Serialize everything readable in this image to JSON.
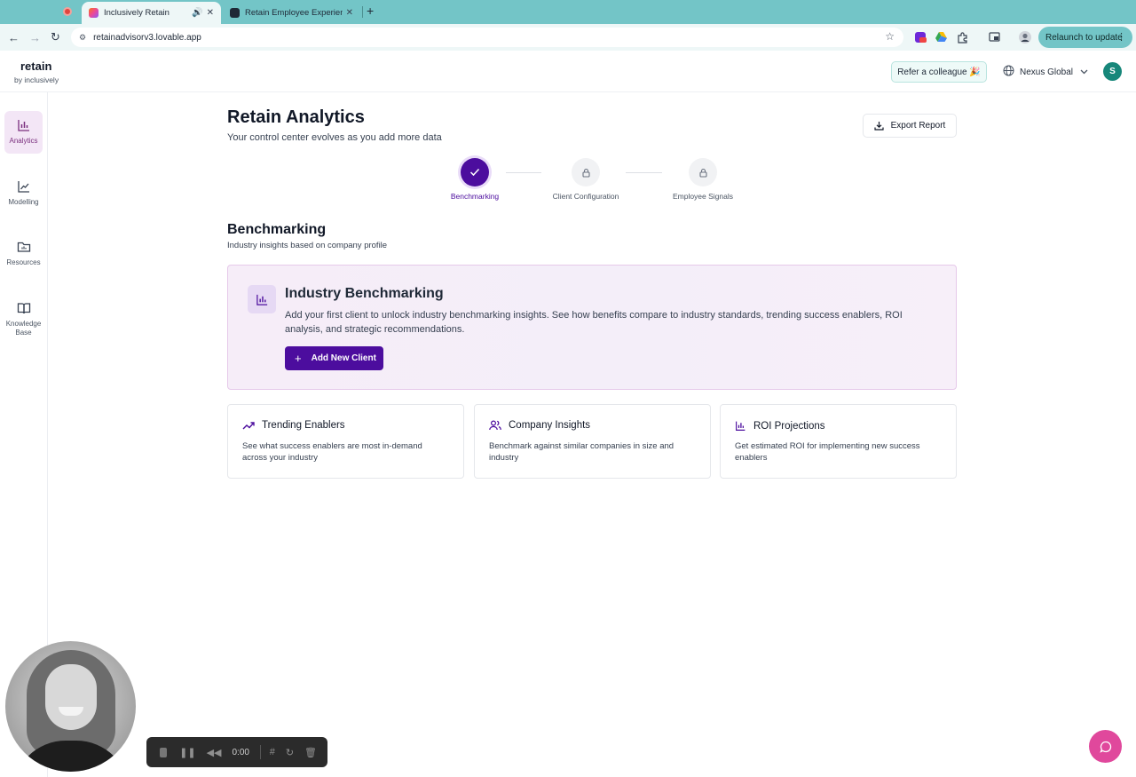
{
  "browser": {
    "tabs": [
      {
        "title": "Inclusively Retain",
        "active": true
      },
      {
        "title": "Retain Employee Experience",
        "active": false
      }
    ],
    "url": "retainadvisorv3.lovable.app",
    "relaunch_label": "Relaunch to update",
    "extension_badge": "on"
  },
  "header": {
    "brand_name": "retain",
    "brand_sub": "by inclusively",
    "refer_label": "Refer a colleague 🎉",
    "org_name": "Nexus Global",
    "avatar_initial": "S"
  },
  "sidebar": {
    "items": [
      {
        "label": "Analytics",
        "icon": "bar-chart-icon",
        "active": true
      },
      {
        "label": "Modelling",
        "icon": "line-chart-icon",
        "active": false
      },
      {
        "label": "Resources",
        "icon": "folder-icon",
        "active": false
      },
      {
        "label": "Knowledge Base",
        "icon": "book-icon",
        "active": false
      }
    ]
  },
  "page": {
    "title": "Retain Analytics",
    "subtitle": "Your control center evolves as you add more data",
    "export_label": "Export Report"
  },
  "steps": [
    {
      "label": "Benchmarking",
      "state": "done"
    },
    {
      "label": "Client Configuration",
      "state": "locked"
    },
    {
      "label": "Employee Signals",
      "state": "locked"
    }
  ],
  "section": {
    "title": "Benchmarking",
    "subtitle": "Industry insights based on company profile"
  },
  "benchmark_card": {
    "title": "Industry Benchmarking",
    "description": "Add your first client to unlock industry benchmarking insights. See how benefits compare to industry standards, trending success enablers, ROI analysis, and strategic recommendations.",
    "button_label": "Add New Client"
  },
  "features": [
    {
      "title": "Trending Enablers",
      "description": "See what success enablers are most in-demand across your industry",
      "icon": "trending-up-icon"
    },
    {
      "title": "Company Insights",
      "description": "Benchmark against similar companies in size and industry",
      "icon": "users-icon"
    },
    {
      "title": "ROI Projections",
      "description": "Get estimated ROI for implementing new success enablers",
      "icon": "bar-chart-icon"
    }
  ],
  "recorder": {
    "time": "0:00"
  },
  "colors": {
    "primary": "#4c0d9e",
    "sidebar_active": "#f3e6f6",
    "teal": "#17877a",
    "chrome": "#73c5c7",
    "chat": "#e0489c"
  }
}
